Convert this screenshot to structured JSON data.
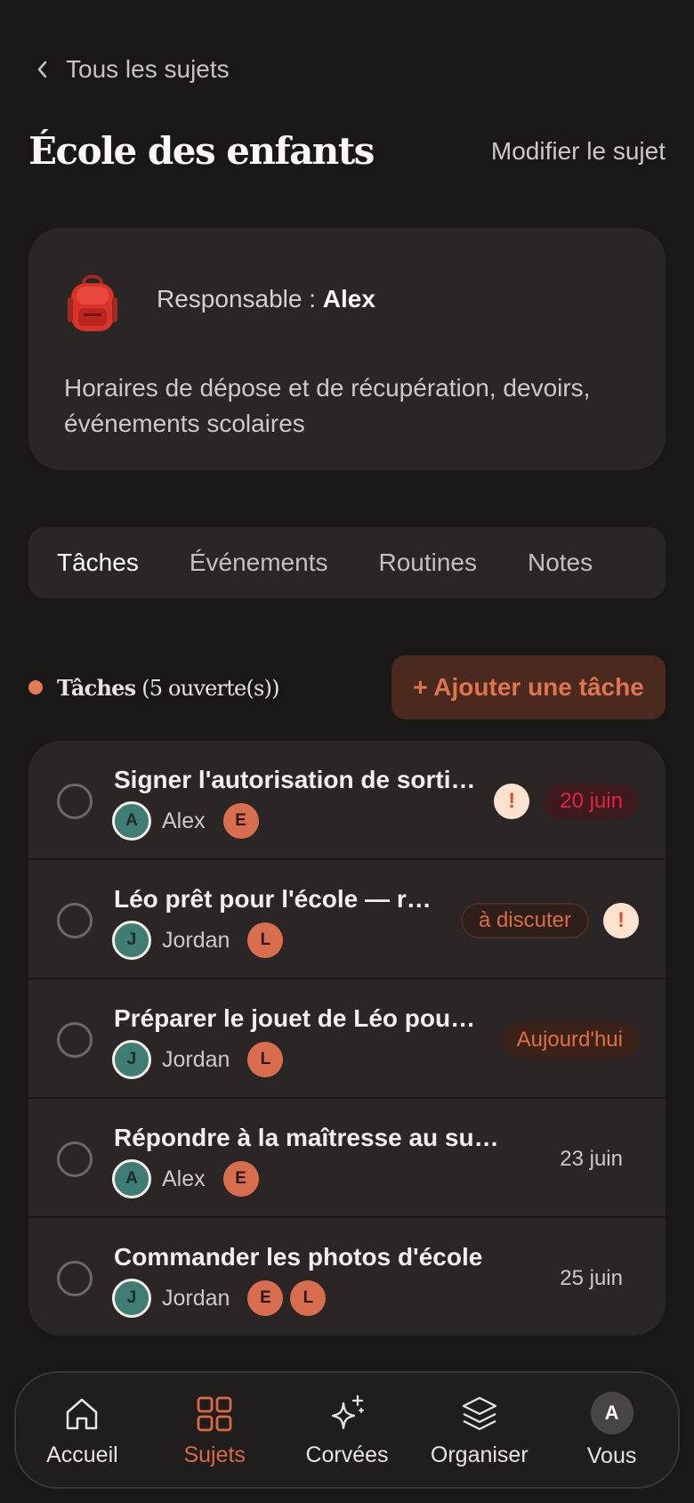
{
  "header": {
    "back_label": "Tous les sujets",
    "title": "École des enfants",
    "edit_label": "Modifier le sujet"
  },
  "info": {
    "icon": "backpack-icon",
    "owner_prefix": "Responsable : ",
    "owner_name": "Alex",
    "description": "Horaires de dépose et de récupération, devoirs, événements scolaires"
  },
  "tabs": [
    {
      "label": "Tâches",
      "active": true
    },
    {
      "label": "Événements",
      "active": false
    },
    {
      "label": "Routines",
      "active": false
    },
    {
      "label": "Notes",
      "active": false
    }
  ],
  "section": {
    "title": "Tâches",
    "count": "(5 ouverte(s))",
    "add_label": "+ Ajouter une tâche"
  },
  "tasks": [
    {
      "title": "Signer l'autorisation de sorti…",
      "owner_initial": "A",
      "owner": "Alex",
      "kids": [
        "E"
      ],
      "alert": "!",
      "badge": "20 juin"
    },
    {
      "title": "Léo prêt pour l'école — r…",
      "owner_initial": "J",
      "owner": "Jordan",
      "kids": [
        "L"
      ],
      "badge": "à discuter",
      "alert": "!"
    },
    {
      "title": "Préparer le jouet de Léo pou…",
      "owner_initial": "J",
      "owner": "Jordan",
      "kids": [
        "L"
      ],
      "badge": "Aujourd'hui"
    },
    {
      "title": "Répondre à la maîtresse au sujet …",
      "owner_initial": "A",
      "owner": "Alex",
      "kids": [
        "E"
      ],
      "date": "23 juin"
    },
    {
      "title": "Commander les photos d'école",
      "owner_initial": "J",
      "owner": "Jordan",
      "kids": [
        "E",
        "L"
      ],
      "date": "25 juin"
    }
  ],
  "nav": [
    {
      "label": "Accueil",
      "icon": "home-icon"
    },
    {
      "label": "Sujets",
      "icon": "grid-icon",
      "active": true
    },
    {
      "label": "Corvées",
      "icon": "sparkle-icon"
    },
    {
      "label": "Organiser",
      "icon": "layers-icon"
    },
    {
      "label": "Vous",
      "avatar_initial": "A"
    }
  ],
  "colors": {
    "background": "#1a1717",
    "card": "#2a2626",
    "accent": "#d96a45",
    "avatar_adult": "#3f7d74",
    "avatar_kid": "#d86e4d",
    "overdue": "#e5223f"
  }
}
